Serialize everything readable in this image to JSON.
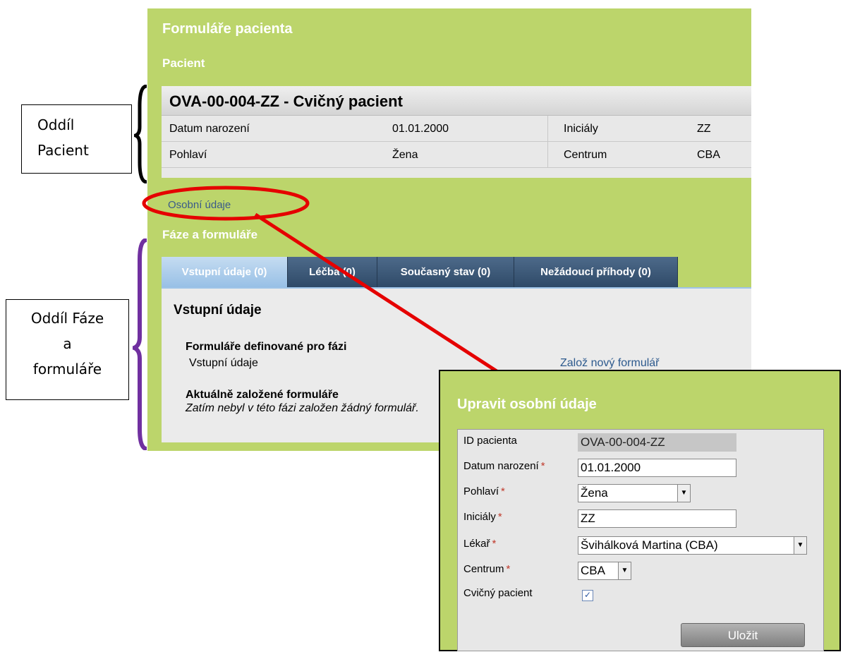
{
  "colors": {
    "panel_green": "#bcd56b",
    "tab_dark": "#2f4a68",
    "tab_active": "#98c0e6",
    "annotation_red": "#e50000",
    "bracket_purple": "#7030a0"
  },
  "main": {
    "title": "Formuláře pacienta",
    "patient_section_label": "Pacient",
    "patient": {
      "header": "OVA-00-004-ZZ - Cvičný pacient",
      "rows": [
        {
          "label1": "Datum narození",
          "value1": "01.01.2000",
          "label2": "Iniciály",
          "value2": "ZZ"
        },
        {
          "label1": "Pohlaví",
          "value1": "Žena",
          "label2": "Centrum",
          "value2": "CBA"
        }
      ]
    },
    "personal_link": "Osobní údaje",
    "phases_section_label": "Fáze a formuláře",
    "tabs": [
      {
        "label": "Vstupní údaje (0)",
        "active": true
      },
      {
        "label": "Léčba (0)",
        "active": false
      },
      {
        "label": "Současný stav (0)",
        "active": false
      },
      {
        "label": "Nežádoucí příhody (0)",
        "active": false
      }
    ],
    "tab_content": {
      "title": "Vstupní údaje",
      "defined_heading": "Formuláře definované pro fázi",
      "defined_form_name": "Vstupní údaje",
      "new_form_link": "Založ nový formulář",
      "created_heading": "Aktuálně založené formuláře",
      "created_empty": "Zatím nebyl v této fázi založen žádný formulář."
    }
  },
  "annotations": {
    "patient_box_lines": [
      "Oddíl",
      "Pacient"
    ],
    "phases_box_lines": [
      "Oddíl Fáze",
      "a",
      "formuláře"
    ]
  },
  "dialog": {
    "title": "Upravit osobní údaje",
    "fields": [
      {
        "label": "ID pacienta",
        "required": false,
        "value": "OVA-00-004-ZZ",
        "type": "readonly"
      },
      {
        "label": "Datum narození",
        "required": true,
        "value": "01.01.2000",
        "type": "text"
      },
      {
        "label": "Pohlaví",
        "required": true,
        "value": "Žena",
        "type": "select"
      },
      {
        "label": "Iniciály",
        "required": true,
        "value": "ZZ",
        "type": "text"
      },
      {
        "label": "Lékař",
        "required": true,
        "value": "Švihálková Martina (CBA)",
        "type": "select"
      },
      {
        "label": "Centrum",
        "required": true,
        "value": "CBA",
        "type": "select"
      },
      {
        "label": "Cvičný pacient",
        "required": false,
        "value": true,
        "type": "checkbox"
      }
    ],
    "required_mark": "*",
    "save_label": "Uložit"
  }
}
